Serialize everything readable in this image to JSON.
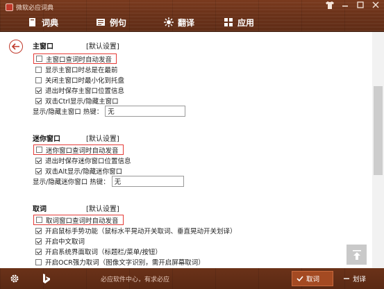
{
  "window": {
    "title": "微软必应词典",
    "controls": [
      "shirt-icon",
      "minimize-icon",
      "maximize-icon",
      "close-icon"
    ]
  },
  "nav": [
    {
      "label": "词典",
      "icon": "book-icon"
    },
    {
      "label": "例句",
      "icon": "list-icon"
    },
    {
      "label": "翻译",
      "icon": "translate-icon"
    },
    {
      "label": "应用",
      "icon": "apps-icon"
    }
  ],
  "sections": {
    "main": {
      "title": "主窗口",
      "default_link": "[默认设置]",
      "options": [
        {
          "label": "主窗口查词时自动发音",
          "checked": false
        },
        {
          "label": "显示主窗口时总是在最前",
          "checked": false
        },
        {
          "label": "关闭主窗口时最小化到托盘",
          "checked": false
        },
        {
          "label": "退出时保存主窗口位置信息",
          "checked": true
        },
        {
          "label": "双击Ctrl显示/隐藏主窗口",
          "checked": true
        }
      ],
      "hotkey_label": "显示/隐藏主窗口 热键：",
      "hotkey_value": "无"
    },
    "mini": {
      "title": "迷你窗口",
      "default_link": "[默认设置]",
      "options": [
        {
          "label": "迷你窗口查词时自动发音",
          "checked": false
        },
        {
          "label": "退出时保存迷你窗口位置信息",
          "checked": true
        },
        {
          "label": "双击Alt显示/隐藏迷你窗口",
          "checked": true
        }
      ],
      "hotkey_label": "显示/隐藏迷你窗口 热键：",
      "hotkey_value": "无"
    },
    "capture": {
      "title": "取词",
      "default_link": "[默认设置]",
      "options": [
        {
          "label": "取词窗口查词时自动发音",
          "checked": false
        },
        {
          "label": "开启鼠标手势功能（鼠标水平晃动开关取词、垂直晃动开关划译）",
          "checked": true
        },
        {
          "label": "开启中文取词",
          "checked": true
        },
        {
          "label": "开启系统界面取词（标题栏/菜单/按钮）",
          "checked": true
        },
        {
          "label": "开启OCR强力取词（图像文字识别，需开启屏幕取词）",
          "checked": false
        }
      ]
    }
  },
  "bottom": {
    "center_text": "必应软件中心，有求必应",
    "capture_button": "取词",
    "highlight_button": "划译"
  },
  "colors": {
    "header_brown": "#6b3219",
    "accent_red": "#c0392b",
    "highlight_border": "#e53935"
  }
}
